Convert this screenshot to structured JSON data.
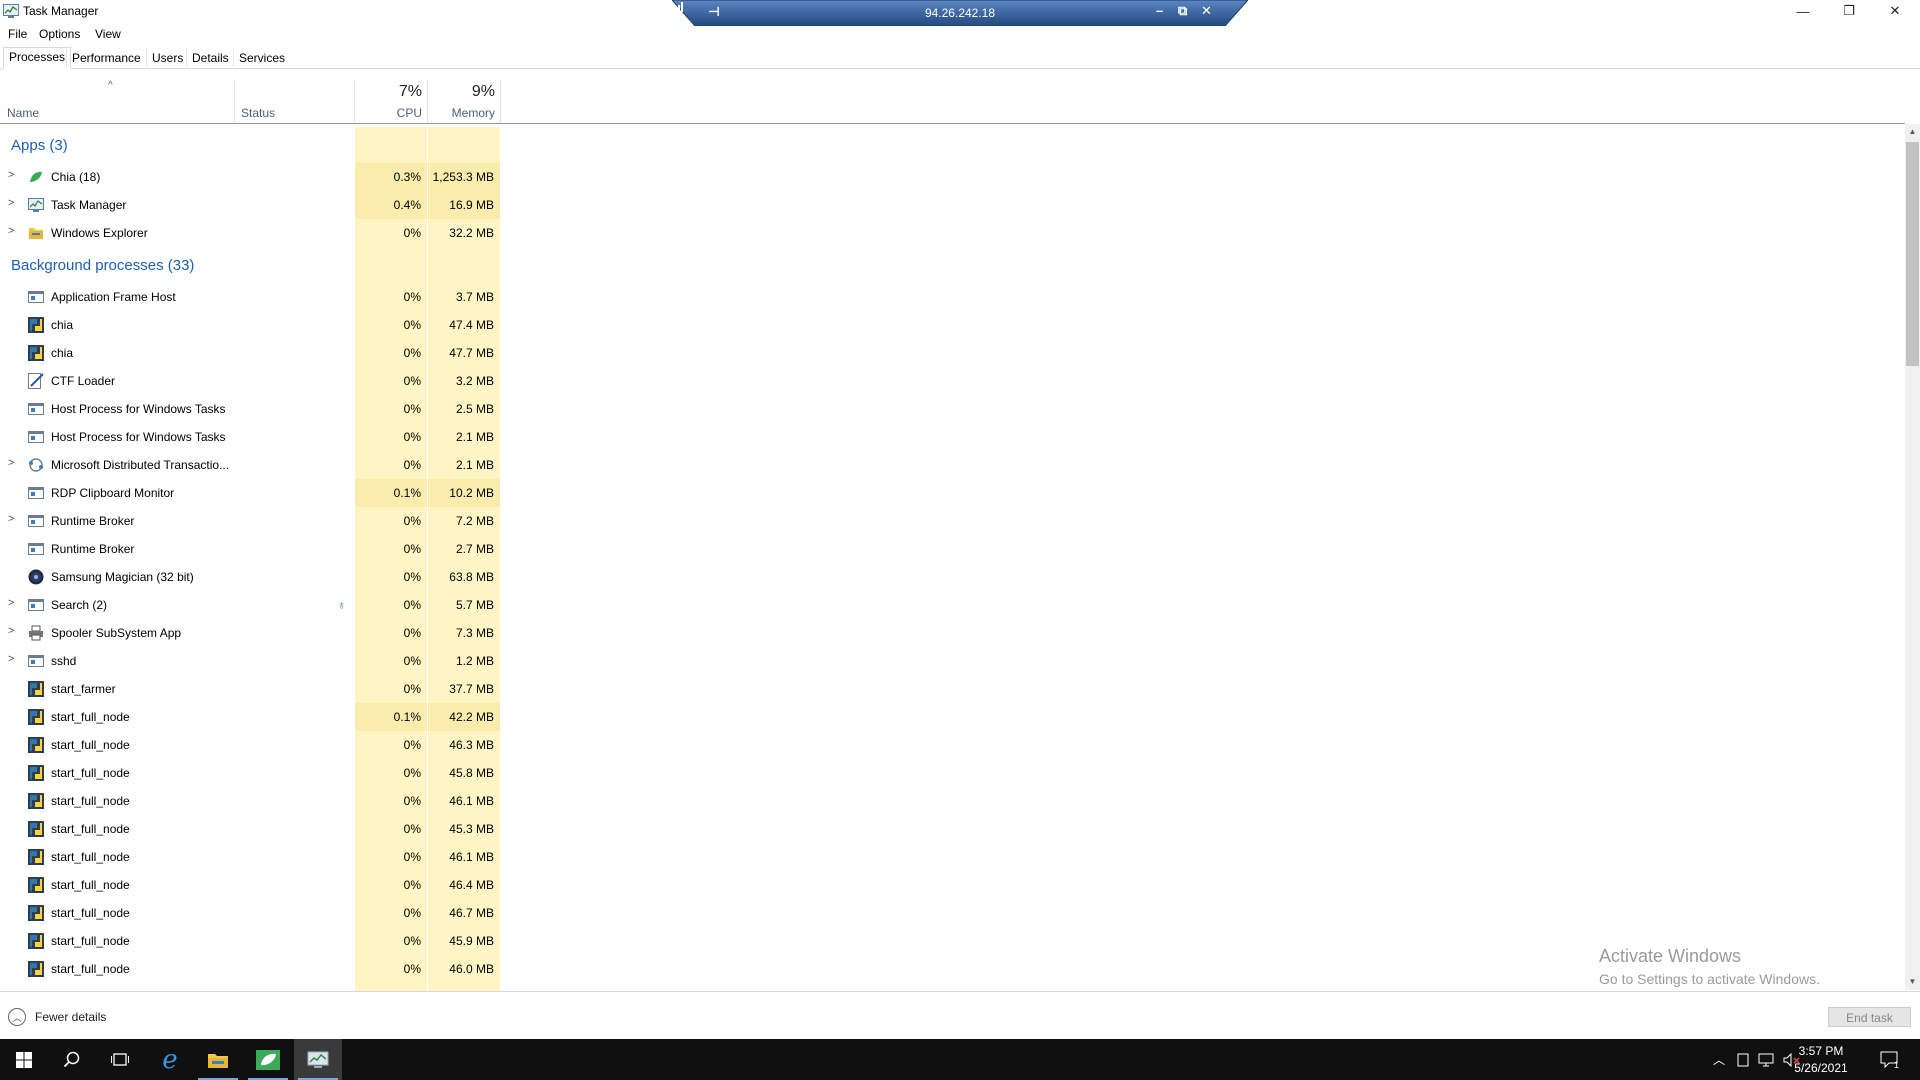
{
  "window": {
    "title": "Task Manager",
    "controls": {
      "minimize": "—",
      "restore": "❐",
      "close": "✕"
    }
  },
  "rdp": {
    "ip": "94.26.242.18",
    "pin_icon": "pin-icon",
    "signal_icon": "signal-icon",
    "controls": {
      "minimize": "–",
      "restore": "⧉",
      "close": "✕"
    }
  },
  "menu": [
    "File",
    "Options",
    "View"
  ],
  "tabs": [
    "Processes",
    "Performance",
    "Users",
    "Details",
    "Services"
  ],
  "columns": {
    "name": "Name",
    "status": "Status",
    "cpu_pct": "7%",
    "cpu": "CPU",
    "mem_pct": "9%",
    "mem": "Memory"
  },
  "groups": {
    "apps": "Apps (3)",
    "background": "Background processes (33)"
  },
  "apps": [
    {
      "name": "Chia (18)",
      "cpu": "0.3%",
      "mem": "1,253.3 MB",
      "icon": "chia-leaf-icon",
      "expandable": true,
      "hl": true
    },
    {
      "name": "Task Manager",
      "cpu": "0.4%",
      "mem": "16.9 MB",
      "icon": "task-manager-icon",
      "expandable": true,
      "hl": true
    },
    {
      "name": "Windows Explorer",
      "cpu": "0%",
      "mem": "32.2 MB",
      "icon": "explorer-icon",
      "expandable": true,
      "hl": false
    }
  ],
  "background": [
    {
      "name": "Application Frame Host",
      "cpu": "0%",
      "mem": "3.7 MB",
      "icon": "window-icon",
      "expandable": false,
      "hl": false
    },
    {
      "name": "chia",
      "cpu": "0%",
      "mem": "47.4 MB",
      "icon": "python-icon",
      "expandable": false,
      "hl": false
    },
    {
      "name": "chia",
      "cpu": "0%",
      "mem": "47.7 MB",
      "icon": "python-icon",
      "expandable": false,
      "hl": false
    },
    {
      "name": "CTF Loader",
      "cpu": "0%",
      "mem": "3.2 MB",
      "icon": "ctf-icon",
      "expandable": false,
      "hl": false
    },
    {
      "name": "Host Process for Windows Tasks",
      "cpu": "0%",
      "mem": "2.5 MB",
      "icon": "window-icon",
      "expandable": false,
      "hl": false
    },
    {
      "name": "Host Process for Windows Tasks",
      "cpu": "0%",
      "mem": "2.1 MB",
      "icon": "window-icon",
      "expandable": false,
      "hl": false
    },
    {
      "name": "Microsoft Distributed Transactio...",
      "cpu": "0%",
      "mem": "2.1 MB",
      "icon": "msdtc-icon",
      "expandable": true,
      "hl": false
    },
    {
      "name": "RDP Clipboard Monitor",
      "cpu": "0.1%",
      "mem": "10.2 MB",
      "icon": "window-icon",
      "expandable": false,
      "hl": true
    },
    {
      "name": "Runtime Broker",
      "cpu": "0%",
      "mem": "7.2 MB",
      "icon": "window-icon",
      "expandable": true,
      "hl": false
    },
    {
      "name": "Runtime Broker",
      "cpu": "0%",
      "mem": "2.7 MB",
      "icon": "window-icon",
      "expandable": false,
      "hl": false
    },
    {
      "name": "Samsung Magician (32 bit)",
      "cpu": "0%",
      "mem": "63.8 MB",
      "icon": "samsung-magician-icon",
      "expandable": false,
      "hl": false
    },
    {
      "name": "Search (2)",
      "cpu": "0%",
      "mem": "5.7 MB",
      "icon": "window-icon",
      "expandable": true,
      "hl": false,
      "status_icon": "suspended-leaf-icon"
    },
    {
      "name": "Spooler SubSystem App",
      "cpu": "0%",
      "mem": "7.3 MB",
      "icon": "printer-icon",
      "expandable": true,
      "hl": false
    },
    {
      "name": "sshd",
      "cpu": "0%",
      "mem": "1.2 MB",
      "icon": "window-icon",
      "expandable": true,
      "hl": false
    },
    {
      "name": "start_farmer",
      "cpu": "0%",
      "mem": "37.7 MB",
      "icon": "python-icon",
      "expandable": false,
      "hl": false
    },
    {
      "name": "start_full_node",
      "cpu": "0.1%",
      "mem": "42.2 MB",
      "icon": "python-icon",
      "expandable": false,
      "hl": true
    },
    {
      "name": "start_full_node",
      "cpu": "0%",
      "mem": "46.3 MB",
      "icon": "python-icon",
      "expandable": false,
      "hl": false
    },
    {
      "name": "start_full_node",
      "cpu": "0%",
      "mem": "45.8 MB",
      "icon": "python-icon",
      "expandable": false,
      "hl": false
    },
    {
      "name": "start_full_node",
      "cpu": "0%",
      "mem": "46.1 MB",
      "icon": "python-icon",
      "expandable": false,
      "hl": false
    },
    {
      "name": "start_full_node",
      "cpu": "0%",
      "mem": "45.3 MB",
      "icon": "python-icon",
      "expandable": false,
      "hl": false
    },
    {
      "name": "start_full_node",
      "cpu": "0%",
      "mem": "46.1 MB",
      "icon": "python-icon",
      "expandable": false,
      "hl": false
    },
    {
      "name": "start_full_node",
      "cpu": "0%",
      "mem": "46.4 MB",
      "icon": "python-icon",
      "expandable": false,
      "hl": false
    },
    {
      "name": "start_full_node",
      "cpu": "0%",
      "mem": "46.7 MB",
      "icon": "python-icon",
      "expandable": false,
      "hl": false
    },
    {
      "name": "start_full_node",
      "cpu": "0%",
      "mem": "45.9 MB",
      "icon": "python-icon",
      "expandable": false,
      "hl": false
    },
    {
      "name": "start_full_node",
      "cpu": "0%",
      "mem": "46.0 MB",
      "icon": "python-icon",
      "expandable": false,
      "hl": false
    }
  ],
  "footer": {
    "fewer_details": "Fewer details",
    "end_task": "End task"
  },
  "watermark": {
    "line1": "Activate Windows",
    "line2": "Go to Settings to activate Windows."
  },
  "taskbar": {
    "items": [
      "windows-start-icon",
      "search-icon",
      "task-view-icon",
      "edge-icon",
      "file-explorer-icon",
      "chia-icon",
      "task-manager-icon"
    ],
    "tray_icons": [
      "chevron-up-icon",
      "tablet-icon",
      "network-icon",
      "volume-muted-icon"
    ],
    "time": "3:57 PM",
    "date": "5/26/2021",
    "notification_count": "1"
  },
  "colors": {
    "accent": "#1a5fb4",
    "cpu_bg": "#fff4c4",
    "cpu_bg_active": "#f9ecac",
    "rdp_bar": "#2e5d9e"
  }
}
